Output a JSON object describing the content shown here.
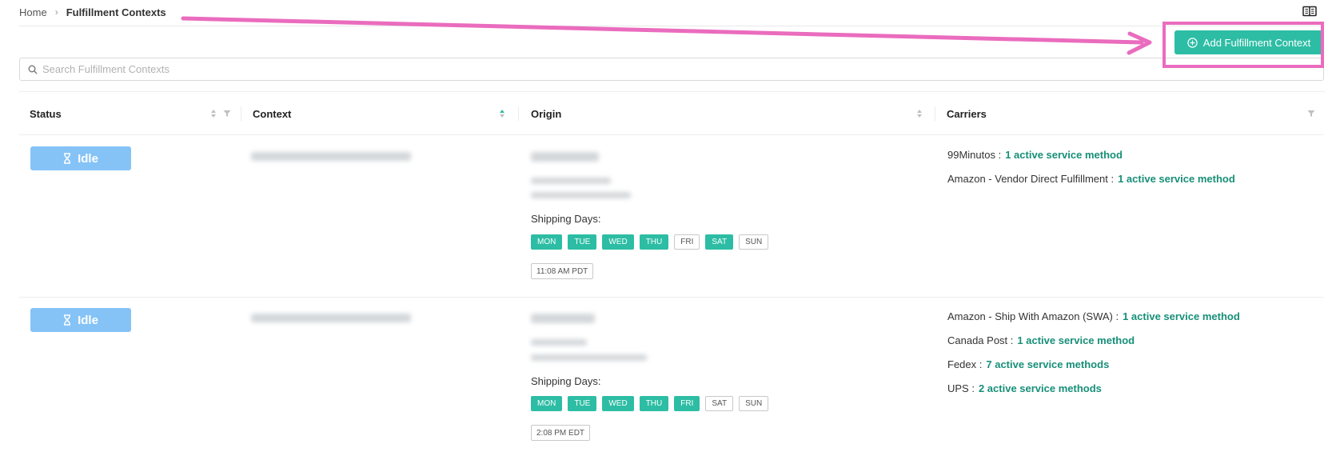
{
  "breadcrumb": {
    "home": "Home",
    "separator": "›",
    "current": "Fulfillment Contexts"
  },
  "toolbar": {
    "add_label": "Add Fulfillment Context"
  },
  "search": {
    "placeholder": "Search Fulfillment Contexts",
    "value": ""
  },
  "table": {
    "columns": [
      {
        "label": "Status"
      },
      {
        "label": "Context"
      },
      {
        "label": "Origin"
      },
      {
        "label": "Carriers"
      }
    ],
    "rows": [
      {
        "status": "Idle",
        "shipping_days_label": "Shipping Days",
        "days": [
          {
            "label": "MON",
            "active": true
          },
          {
            "label": "TUE",
            "active": true
          },
          {
            "label": "WED",
            "active": true
          },
          {
            "label": "THU",
            "active": true
          },
          {
            "label": "FRI",
            "active": false
          },
          {
            "label": "SAT",
            "active": true
          },
          {
            "label": "SUN",
            "active": false
          }
        ],
        "cutoff_time": "11:08 AM PDT",
        "carriers": [
          {
            "name": "99Minutos",
            "link": "1 active service method"
          },
          {
            "name": "Amazon - Vendor Direct Fulfillment",
            "link": "1 active service method"
          }
        ]
      },
      {
        "status": "Idle",
        "shipping_days_label": "Shipping Days",
        "days": [
          {
            "label": "MON",
            "active": true
          },
          {
            "label": "TUE",
            "active": true
          },
          {
            "label": "WED",
            "active": true
          },
          {
            "label": "THU",
            "active": true
          },
          {
            "label": "FRI",
            "active": true
          },
          {
            "label": "SAT",
            "active": false
          },
          {
            "label": "SUN",
            "active": false
          }
        ],
        "cutoff_time": "2:08 PM EDT",
        "carriers": [
          {
            "name": "Amazon - Ship With Amazon (SWA)",
            "link": "1 active service method"
          },
          {
            "name": "Canada Post",
            "link": "1 active service method"
          },
          {
            "name": "Fedex",
            "link": "7 active service methods"
          },
          {
            "name": "UPS",
            "link": "2 active service methods"
          }
        ]
      }
    ]
  },
  "colors": {
    "accent": "#2dbda4",
    "status_idle": "#85c3f6",
    "link": "#178f78",
    "annotation": "#ea6cbe"
  },
  "icons": {
    "book": "book-open-icon",
    "add": "plus-circle-icon",
    "search": "search-icon",
    "sort": "sort-icon",
    "filter": "filter-icon",
    "status": "hourglass-icon"
  }
}
